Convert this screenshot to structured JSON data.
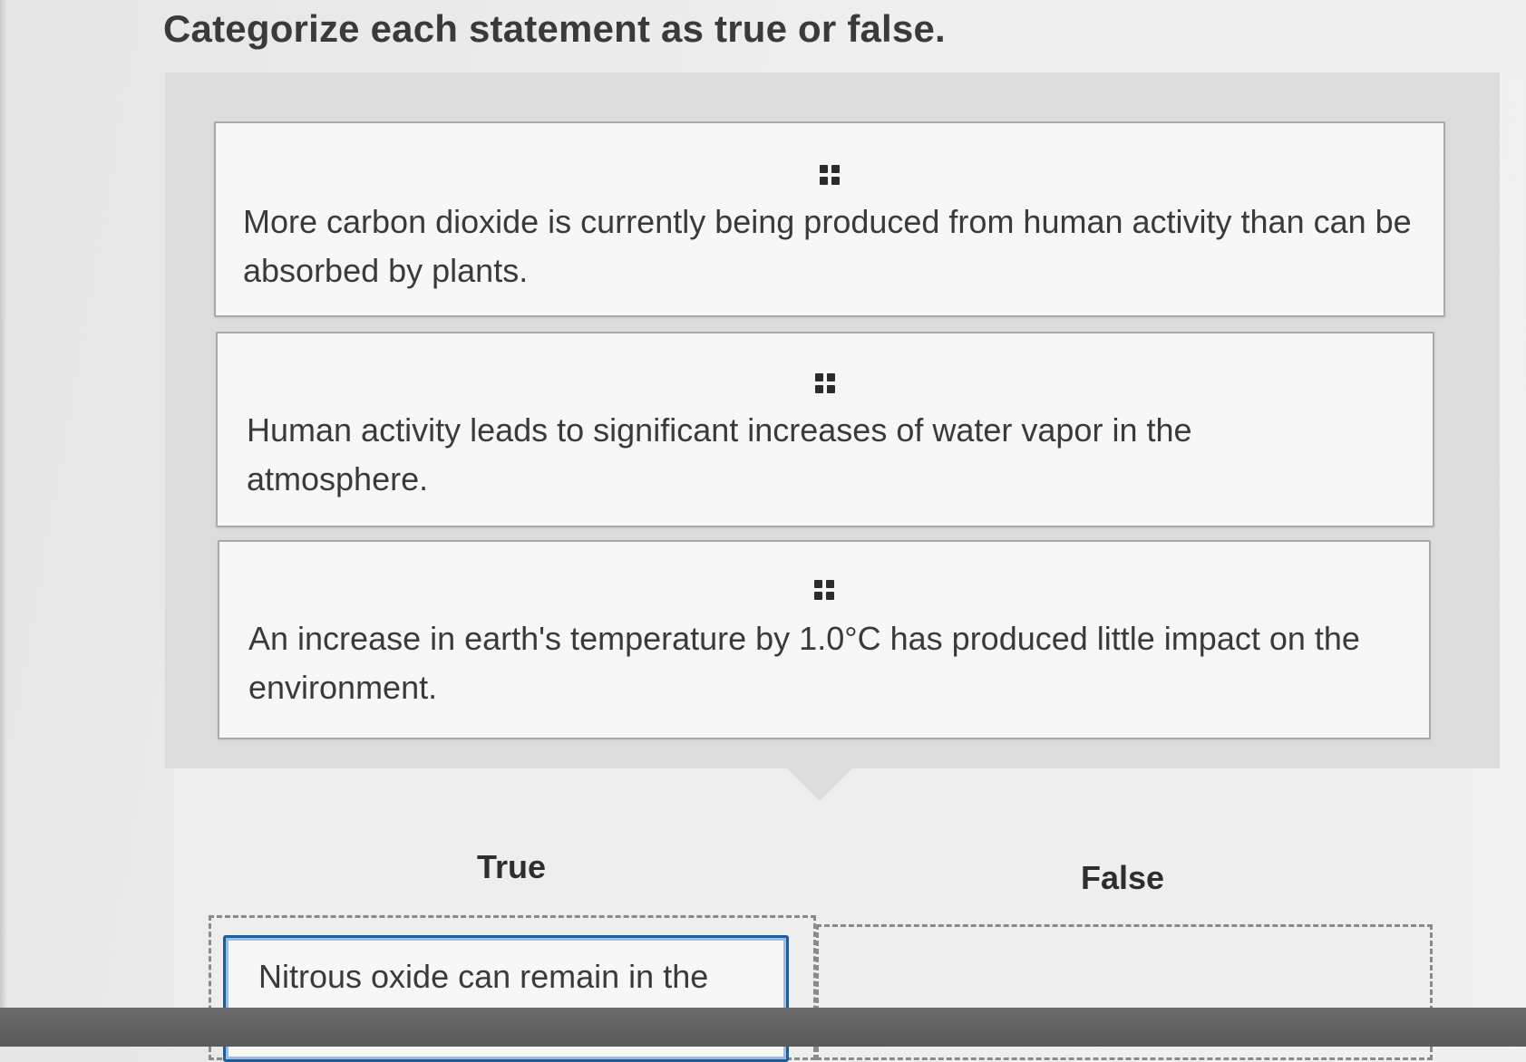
{
  "instruction": "Categorize each statement as true or false.",
  "statement_cards": [
    {
      "text": "More carbon dioxide is currently being produced from human activity than can be absorbed by plants."
    },
    {
      "text": "Human activity leads to significant increases of water vapor in the atmosphere."
    },
    {
      "text": "An increase in earth's temperature by 1.0°C has produced little impact on the environment."
    }
  ],
  "bins": {
    "true_label": "True",
    "false_label": "False",
    "true_placed": [
      {
        "text": "Nitrous oxide can remain in the"
      }
    ]
  },
  "icons": {
    "card_handle": "drag-handle-icon"
  }
}
